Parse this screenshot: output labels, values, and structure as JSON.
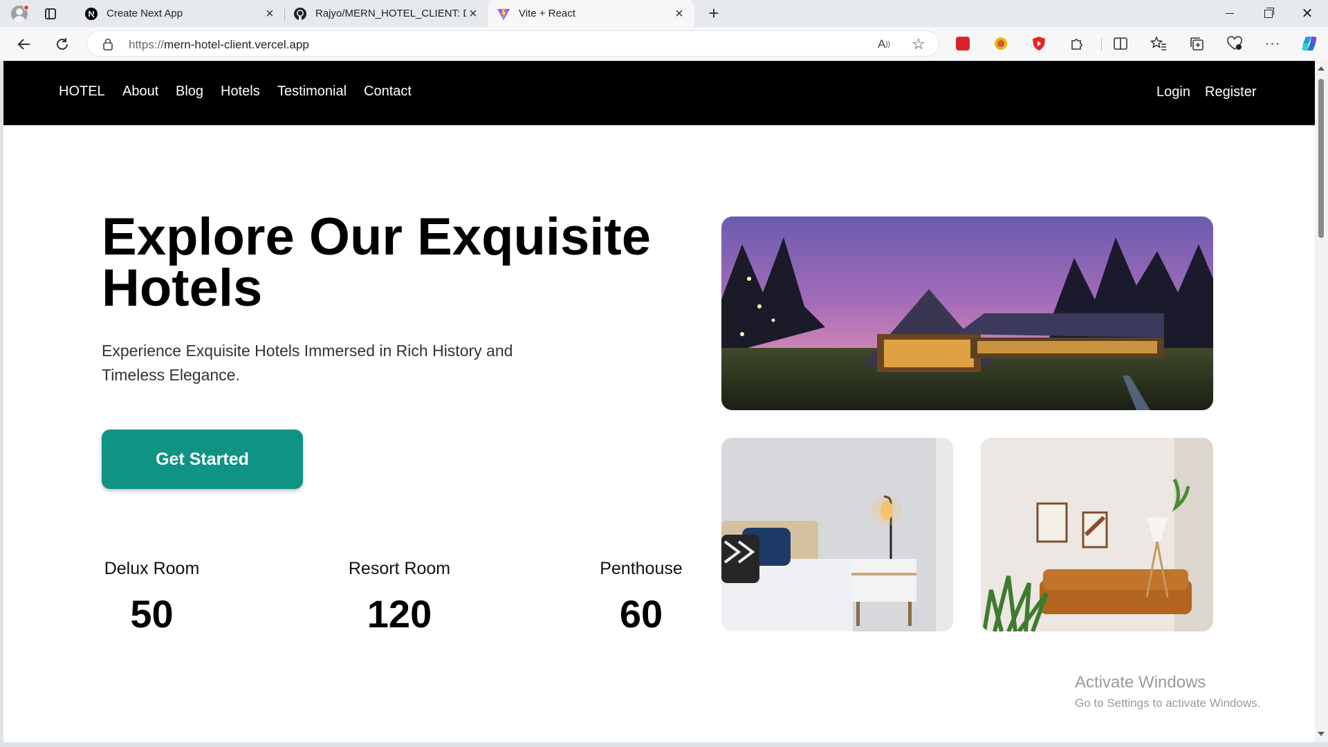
{
  "browser": {
    "tabs": [
      {
        "title": "Create Next App",
        "icon": "nextjs-icon"
      },
      {
        "title": "Rajyo/MERN_HOTEL_CLIENT: Dev",
        "icon": "github-icon"
      },
      {
        "title": "Vite + React",
        "icon": "vite-icon",
        "active": true
      }
    ],
    "address": {
      "protocol": "https://",
      "host": "mern-hotel-client.vercel.app"
    }
  },
  "site": {
    "nav": {
      "brand": "HOTEL",
      "links": [
        "About",
        "Blog",
        "Hotels",
        "Testimonial",
        "Contact"
      ],
      "login": "Login",
      "register": "Register"
    },
    "hero": {
      "title_line1": "Explore Our Exquisite",
      "title_line2": "Hotels",
      "subtitle": "Experience Exquisite Hotels Immersed in Rich History and Timeless Elegance.",
      "cta": "Get Started",
      "accent_color": "#0f9384"
    },
    "stats": [
      {
        "label": "Delux Room",
        "value": "50"
      },
      {
        "label": "Resort Room",
        "value": "120"
      },
      {
        "label": "Penthouse",
        "value": "60"
      }
    ]
  },
  "os": {
    "watermark_title": "Activate Windows",
    "watermark_sub": "Go to Settings to activate Windows."
  }
}
